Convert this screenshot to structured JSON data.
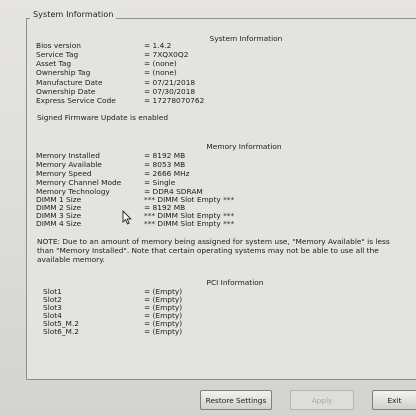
{
  "window": {
    "legend": "System Information"
  },
  "system": {
    "title": "System Information",
    "rows": [
      {
        "label": "Bios version",
        "value": "= 1.4.2"
      },
      {
        "label": "Service Tag",
        "value": "= 7XQX0Q2"
      },
      {
        "label": "Asset Tag",
        "value": "= (none)"
      },
      {
        "label": "Ownership Tag",
        "value": "= (none)"
      },
      {
        "label": "Manufacture Date",
        "value": "= 07/21/2018"
      },
      {
        "label": "Ownership Date",
        "value": "= 07/30/2018"
      },
      {
        "label": "Express Service Code",
        "value": "= 17278070762"
      }
    ],
    "signed": "Signed Firmware Update is enabled"
  },
  "memory": {
    "title": "Memory Information",
    "rows": [
      {
        "label": "Memory Installed",
        "value": "= 8192 MB"
      },
      {
        "label": "Memory Available",
        "value": "= 8053 MB"
      },
      {
        "label": "Memory Speed",
        "value": "= 2666 MHz"
      },
      {
        "label": "Memory Channel Mode",
        "value": "= Single"
      },
      {
        "label": "Memory Technology",
        "value": "= DDR4 SDRAM"
      },
      {
        "label": "DIMM 1 Size",
        "value": "*** DIMM Slot Empty ***"
      },
      {
        "label": "DIMM 2 Size",
        "value": "= 8192 MB"
      },
      {
        "label": "DIMM 3 Size",
        "value": "*** DIMM Slot Empty ***"
      },
      {
        "label": "DIMM 4 Size",
        "value": "*** DIMM Slot Empty ***"
      }
    ],
    "note": "NOTE: Due to an amount of memory being assigned for system use, \"Memory Available\" is less than \"Memory Installed\". Note that certain operating systems may not be able to use all the available memory."
  },
  "pci": {
    "title": "PCI Information",
    "rows": [
      {
        "label": "Slot1",
        "value": "= (Empty)"
      },
      {
        "label": "Slot2",
        "value": "= (Empty)"
      },
      {
        "label": "Slot3",
        "value": "= (Empty)"
      },
      {
        "label": "Slot4",
        "value": "= (Empty)"
      },
      {
        "label": "Slot5_M.2",
        "value": "= (Empty)"
      },
      {
        "label": "Slot6_M.2",
        "value": "= (Empty)"
      }
    ]
  },
  "buttons": {
    "restore": "Restore Settings",
    "apply": "Apply",
    "exit": "Exit"
  }
}
